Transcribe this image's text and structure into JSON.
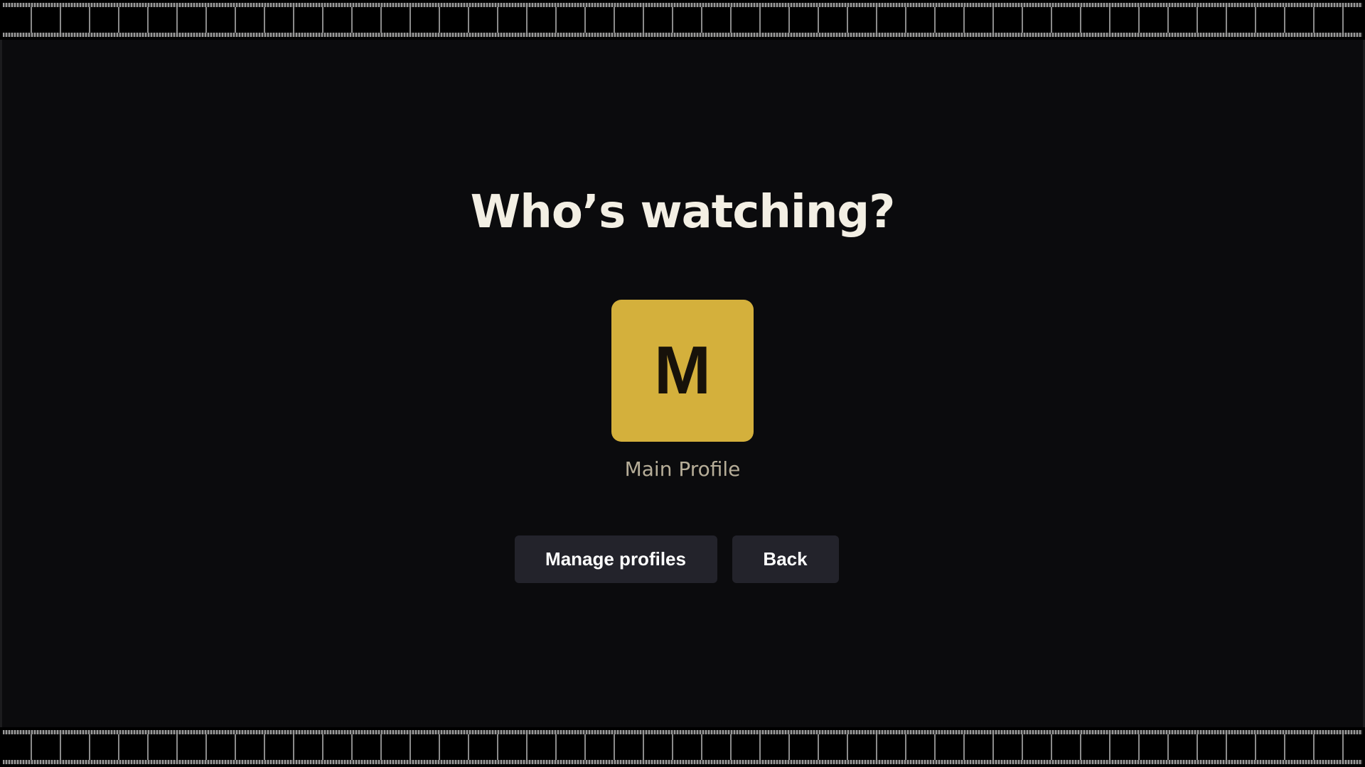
{
  "page": {
    "title": "Who’s watching?"
  },
  "profiles": [
    {
      "initial": "M",
      "name": "Main Profile",
      "color": "#d4b03c"
    }
  ],
  "actions": {
    "manage_label": "Manage profiles",
    "back_label": "Back"
  },
  "colors": {
    "background": "#0b0b0d",
    "title": "#f3efe4",
    "profile_name": "#b6ad98",
    "button_bg": "#23232b",
    "button_text": "#ffffff",
    "accent": "#d4b03c"
  }
}
